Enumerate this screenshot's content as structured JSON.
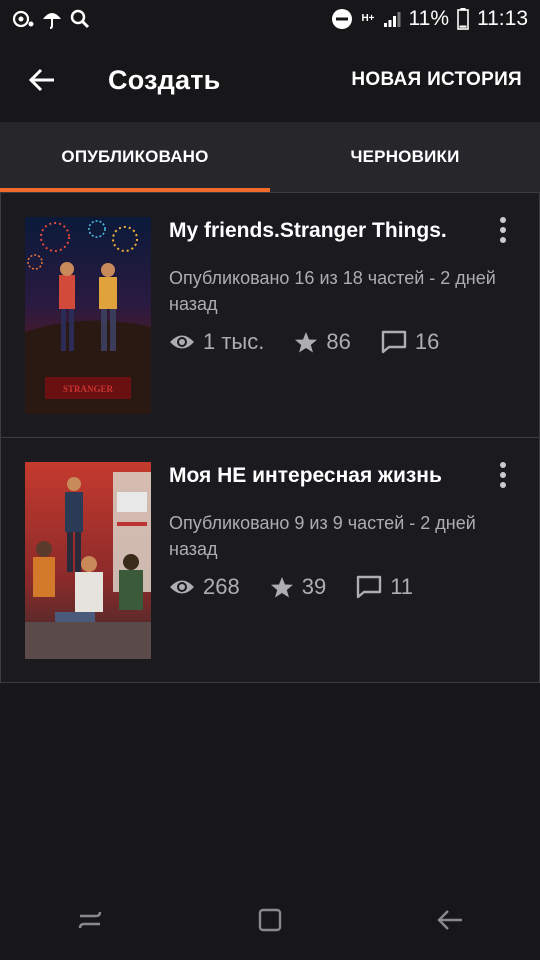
{
  "status_bar": {
    "battery": "11%",
    "time": "11:13",
    "network": "H+",
    "icons": [
      "notification-icon",
      "umbrella-icon",
      "search-icon",
      "do-not-disturb-icon",
      "signal-icon",
      "battery-icon"
    ]
  },
  "app_bar": {
    "title": "Создать",
    "action_label": "НОВАЯ ИСТОРИЯ"
  },
  "tabs": [
    {
      "label": "ОПУБЛИКОВАНО",
      "active": true
    },
    {
      "label": "ЧЕРНОВИКИ",
      "active": false
    }
  ],
  "stories": [
    {
      "title": "My friends.Stranger Things.",
      "meta": "Опубликовано 16 из 18 частей - 2 дней назад",
      "views": "1 тыс.",
      "votes": "86",
      "comments": "16"
    },
    {
      "title": "Моя НЕ интересная жизнь",
      "meta": "Опубликовано 9 из 9 частей - 2 дней назад",
      "views": "268",
      "votes": "39",
      "comments": "11"
    }
  ],
  "colors": {
    "accent": "#f06b2b",
    "background": "#171619",
    "tab_bar": "#27262a",
    "secondary_text": "#aeadb2"
  }
}
